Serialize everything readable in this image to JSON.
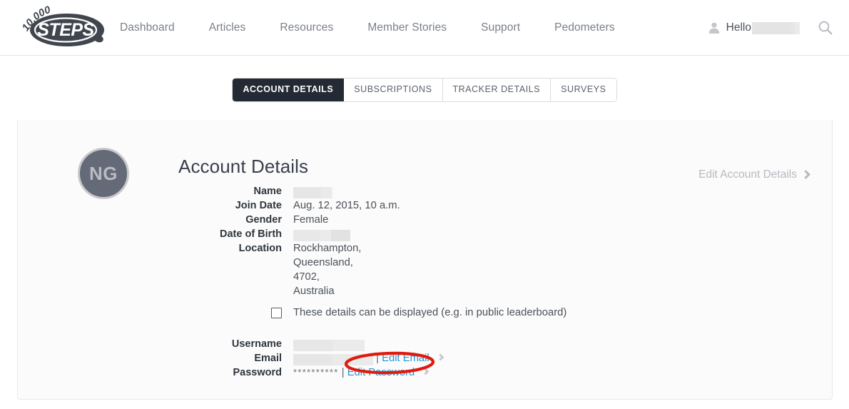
{
  "header": {
    "logo": {
      "top_text": "10,000",
      "main_text": "STEPS",
      "name": "10,000 Steps logo"
    },
    "nav": [
      {
        "label": "Dashboard"
      },
      {
        "label": "Articles"
      },
      {
        "label": "Resources"
      },
      {
        "label": "Member Stories"
      },
      {
        "label": "Support"
      },
      {
        "label": "Pedometers"
      }
    ],
    "greeting": "Hello",
    "greeting_name_redacted": "",
    "person_icon": "person-icon",
    "search_icon": "search-icon"
  },
  "tabs": [
    {
      "label": "ACCOUNT DETAILS",
      "active": true
    },
    {
      "label": "SUBSCRIPTIONS",
      "active": false
    },
    {
      "label": "TRACKER DETAILS",
      "active": false
    },
    {
      "label": "SURVEYS",
      "active": false
    }
  ],
  "panel": {
    "avatar_initials": "NG",
    "title": "Account Details",
    "edit_account_label": "Edit Account Details",
    "fields": [
      {
        "label": "Name",
        "value": "",
        "redacted": true
      },
      {
        "label": "Join Date",
        "value": "Aug. 12, 2015, 10 a.m.",
        "redacted": false
      },
      {
        "label": "Gender",
        "value": "Female",
        "redacted": false
      },
      {
        "label": "Date of Birth",
        "value": "",
        "redacted": true
      },
      {
        "label": "Location",
        "value": "Rockhampton,\nQueensland,\n4702,\nAustralia",
        "redacted": false
      }
    ],
    "location_lines": [
      "Rockhampton,",
      "Queensland,",
      "4702,",
      "Australia"
    ],
    "display_checkbox": {
      "label": "These details can be displayed (e.g. in public leaderboard)",
      "checked": false
    },
    "credentials": {
      "username_label": "Username",
      "username_value": "",
      "email_label": "Email",
      "email_value": "",
      "edit_email_label": "Edit Email",
      "password_label": "Password",
      "password_value": "**********",
      "edit_password_label": "Edit Password",
      "separator": "|"
    }
  },
  "annotation": {
    "shape": "ellipse",
    "color": "#e01b0e",
    "target": "Edit Password"
  },
  "colors": {
    "dark_bar": "#242a34",
    "link_blue": "#2196d6",
    "muted_text": "#7a7f87",
    "panel_bg": "#fbfbfb",
    "annotation_red": "#e01b0e"
  }
}
